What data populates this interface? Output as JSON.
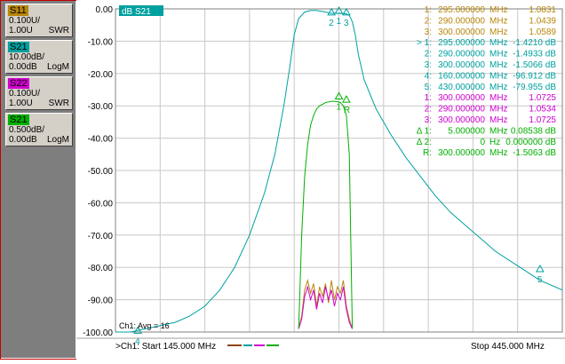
{
  "sidebar": {
    "traces": [
      {
        "name": "S11",
        "bg": "#b8860b",
        "scale": "0.100U/",
        "ref": "1.00U",
        "format": "SWR"
      },
      {
        "name": "S21",
        "bg": "#00a0a0",
        "scale": "10.00dB/",
        "ref": "0.00dB",
        "format": "LogM"
      },
      {
        "name": "S22",
        "bg": "#d000d0",
        "scale": "0.100U/",
        "ref": "1.00U",
        "format": "SWR"
      },
      {
        "name": "S21",
        "bg": "#00b000",
        "scale": "0.500dB/",
        "ref": "0.00dB",
        "format": "LogM"
      }
    ]
  },
  "chart_data": {
    "type": "line",
    "active_trace_label": "dB S21",
    "y_ticks": [
      "0.00",
      "-10.00",
      "-20.00",
      "-30.00",
      "-40.00",
      "-50.00",
      "-60.00",
      "-70.00",
      "-80.00",
      "-90.00",
      "-100.00"
    ],
    "ylim": [
      -100,
      0
    ],
    "xlim": [
      145,
      445
    ],
    "grid": true,
    "footer": {
      "start": ">Ch1: Start  145.000 MHz",
      "stop": "Stop  445.000 MHz",
      "avg": "Ch1: Avg = 16"
    },
    "colors": {
      "s11": "#b8860b",
      "s21_log": "#00a0a0",
      "s22": "#d000d0",
      "s21_fine": "#00b000"
    },
    "series": [
      {
        "name": "S21",
        "color": "#00a0a0",
        "x": [
          145,
          155,
          165,
          175,
          185,
          195,
          205,
          215,
          225,
          235,
          245,
          252,
          258,
          262,
          265,
          268,
          272,
          276,
          280,
          284,
          286,
          288,
          290,
          292,
          295,
          298,
          300,
          302,
          304,
          306,
          308,
          312,
          320,
          330,
          340,
          350,
          360,
          370,
          380,
          390,
          400,
          410,
          420,
          430,
          440,
          445
        ],
        "y": [
          -100,
          -100,
          -99,
          -98,
          -97,
          -95,
          -92,
          -87,
          -80,
          -70,
          -57,
          -45,
          -30,
          -18,
          -8,
          -3,
          -1,
          -0.5,
          -0.5,
          -0.8,
          -1.0,
          -1.2,
          -1.4,
          -1.4,
          -1.4,
          -1.5,
          -1.5,
          -2,
          -4,
          -8,
          -14,
          -22,
          -31,
          -39,
          -46,
          -52,
          -58,
          -63,
          -67,
          -71,
          -75,
          -78,
          -81,
          -84,
          -86,
          -87
        ]
      },
      {
        "name": "S11",
        "color": "#b8860b",
        "x": [
          268,
          270,
          272,
          274,
          276,
          278,
          280,
          282,
          284,
          286,
          288,
          290,
          292,
          294,
          296,
          298,
          300,
          302,
          304
        ],
        "y": [
          -99,
          -95,
          -87,
          -84,
          -88,
          -85,
          -92,
          -86,
          -89,
          -85,
          -91,
          -84,
          -90,
          -86,
          -88,
          -84,
          -92,
          -96,
          -99
        ]
      },
      {
        "name": "S22",
        "color": "#d000d0",
        "x": [
          268,
          270,
          272,
          274,
          276,
          278,
          280,
          282,
          284,
          286,
          288,
          290,
          292,
          294,
          296,
          298,
          300,
          302,
          304
        ],
        "y": [
          -99,
          -96,
          -89,
          -86,
          -90,
          -87,
          -93,
          -88,
          -91,
          -86,
          -90,
          -87,
          -92,
          -88,
          -90,
          -86,
          -93,
          -97,
          -99
        ]
      },
      {
        "name": "S21",
        "color": "#00b000",
        "x": [
          268,
          270,
          272,
          274,
          276,
          278,
          280,
          282,
          284,
          286,
          288,
          290,
          292,
          294,
          296,
          298,
          300,
          302,
          304
        ],
        "y": [
          -99,
          -70,
          -52,
          -42,
          -36,
          -33,
          -31,
          -30,
          -29.5,
          -29,
          -28.8,
          -28.6,
          -28.6,
          -28.7,
          -29,
          -30,
          -33,
          -45,
          -99
        ]
      }
    ],
    "markers_on_plot": [
      {
        "label": "2",
        "x": 290,
        "y": -0.5,
        "color": "#00a0a0"
      },
      {
        "label": "1",
        "x": 295,
        "y": 0,
        "color": "#00a0a0"
      },
      {
        "label": "3",
        "x": 300,
        "y": -0.5,
        "color": "#00a0a0"
      },
      {
        "label": "4",
        "x": 160,
        "y": -99,
        "color": "#00a0a0"
      },
      {
        "label": "5",
        "x": 430,
        "y": -79.955,
        "color": "#00a0a0"
      },
      {
        "label": "1",
        "x": 295,
        "y": -26.5,
        "color": "#00b000"
      },
      {
        "label": "R",
        "x": 300,
        "y": -27.5,
        "color": "#00b000"
      }
    ],
    "marker_table": [
      {
        "color": "#b8860b",
        "id": "1:",
        "freq": "295.000000",
        "unit": "MHz",
        "value": "1.0831"
      },
      {
        "color": "#b8860b",
        "id": "2:",
        "freq": "290.000000",
        "unit": "MHz",
        "value": "1.0439"
      },
      {
        "color": "#b8860b",
        "id": "3:",
        "freq": "300.000000",
        "unit": "MHz",
        "value": "1.0589"
      },
      {
        "color": "#00a0a0",
        "id": "> 1:",
        "freq": "295.000000",
        "unit": "MHz",
        "value": "-1.4210 dB"
      },
      {
        "color": "#00a0a0",
        "id": "2:",
        "freq": "290.000000",
        "unit": "MHz",
        "value": "-1.4933 dB"
      },
      {
        "color": "#00a0a0",
        "id": "3:",
        "freq": "300.000000",
        "unit": "MHz",
        "value": "-1.5066 dB"
      },
      {
        "color": "#00a0a0",
        "id": "4:",
        "freq": "160.000000",
        "unit": "MHz",
        "value": "-96.912 dB"
      },
      {
        "color": "#00a0a0",
        "id": "5:",
        "freq": "430.000000",
        "unit": "MHz",
        "value": "-79.955 dB"
      },
      {
        "color": "#d000d0",
        "id": "1:",
        "freq": "300.000000",
        "unit": "MHz",
        "value": "1.0725"
      },
      {
        "color": "#d000d0",
        "id": "2:",
        "freq": "290.000000",
        "unit": "MHz",
        "value": "1.0534"
      },
      {
        "color": "#d000d0",
        "id": "3:",
        "freq": "300.000000",
        "unit": "MHz",
        "value": "1.0725"
      },
      {
        "color": "#00b000",
        "id": "Δ 1:",
        "freq": "5.000000",
        "unit": "MHz",
        "value": "0.08538 dB"
      },
      {
        "color": "#00b000",
        "id": "Δ 2:",
        "freq": "0",
        "unit": "Hz",
        "value": "0.000000 dB"
      },
      {
        "color": "#00b000",
        "id": "R:",
        "freq": "300.000000",
        "unit": "MHz",
        "value": "-1.5063 dB"
      }
    ]
  }
}
